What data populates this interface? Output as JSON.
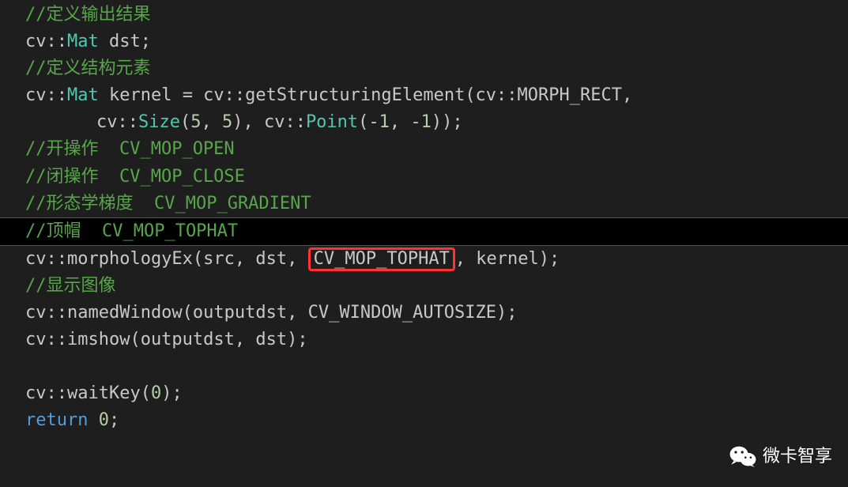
{
  "lines": {
    "l1_comment": "//定义输出结果",
    "l2_ns": "cv::",
    "l2_type": "Mat",
    "l2_rest": " dst;",
    "l3_comment": "//定义结构元素",
    "l4_ns": "cv::",
    "l4_type": "Mat",
    "l4_mid1": " kernel = cv::getStructuringElement(cv::MORPH_RECT,",
    "l5_pre": "cv::",
    "l5_size": "Size",
    "l5_paren1": "(",
    "l5_n1": "5",
    "l5_comma1": ", ",
    "l5_n2": "5",
    "l5_mid": "), cv::",
    "l5_point": "Point",
    "l5_paren2": "(-",
    "l5_n3": "1",
    "l5_comma2": ", -",
    "l5_n4": "1",
    "l5_end": "));",
    "l6_comment": "//开操作  CV_MOP_OPEN",
    "l7_comment": "//闭操作  CV_MOP_CLOSE",
    "l8_comment": "//形态学梯度  CV_MOP_GRADIENT",
    "l9_comment": "//顶帽  CV_MOP_TOPHAT",
    "l10_pre": "cv::morphologyEx(src, dst, ",
    "l10_boxed": "CV_MOP_TOPHAT",
    "l10_post": ", kernel);",
    "l11_comment": "//显示图像",
    "l12": "cv::namedWindow(outputdst, CV_WINDOW_AUTOSIZE);",
    "l13": "cv::imshow(outputdst, dst);",
    "l14_pre": "cv::waitKey(",
    "l14_num": "0",
    "l14_post": ");",
    "l15_kw": "return",
    "l15_sp": " ",
    "l15_num": "0",
    "l15_end": ";"
  },
  "watermark": {
    "text": "微卡智享",
    "icon": "wechat-icon"
  }
}
